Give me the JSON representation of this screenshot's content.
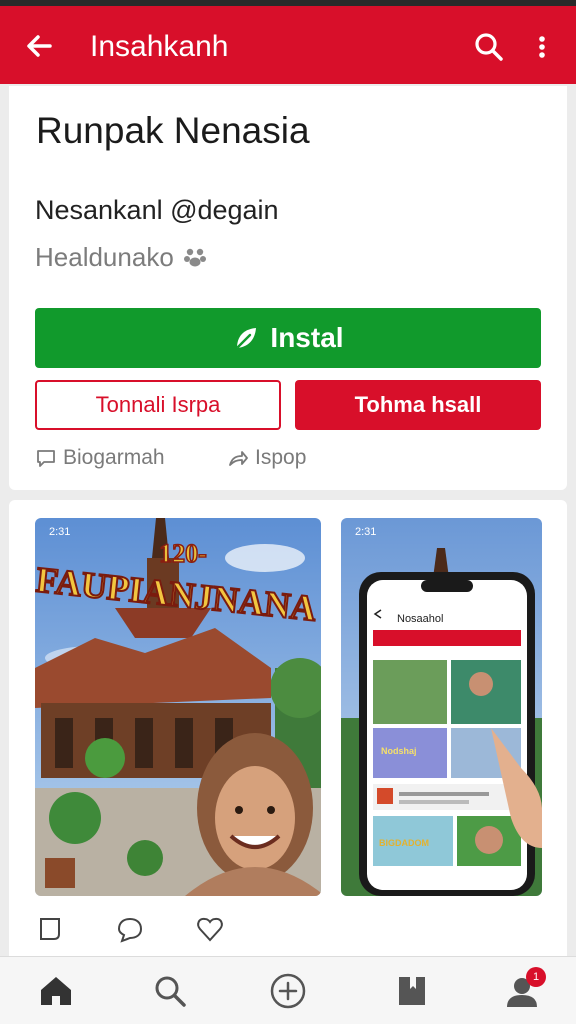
{
  "header": {
    "title": "Insahkanh",
    "back_icon": "arrow-left-icon",
    "search_icon": "search-icon",
    "more_icon": "more-vertical-icon"
  },
  "app": {
    "title": "Runpak Nenasia",
    "developer": "Nesankanl @degain",
    "category": "Healdunako",
    "category_icon": "paw-icon"
  },
  "buttons": {
    "install": "Instal",
    "secondary_outline": "Tonnali Isrpa",
    "secondary_filled": "Tohma hsall"
  },
  "links": {
    "comments": "Biogarmah",
    "share": "Ispop"
  },
  "screenshots": {
    "shot1": {
      "status_time": "2:31",
      "banner_top": "120-",
      "banner_text": "FAUPIANJNANA"
    },
    "shot2": {
      "status_time": "2:31",
      "phone_title": "Nosaahol",
      "card_text_1": "Nodshaj",
      "card_text_2": "BIGDADOM"
    }
  },
  "colors": {
    "brand_red": "#d80f2a",
    "install_green": "#119a2c"
  },
  "nav": {
    "items": [
      "home-icon",
      "search-icon",
      "add-circle-icon",
      "bookmark-icon",
      "profile-icon"
    ],
    "badge": "1"
  }
}
